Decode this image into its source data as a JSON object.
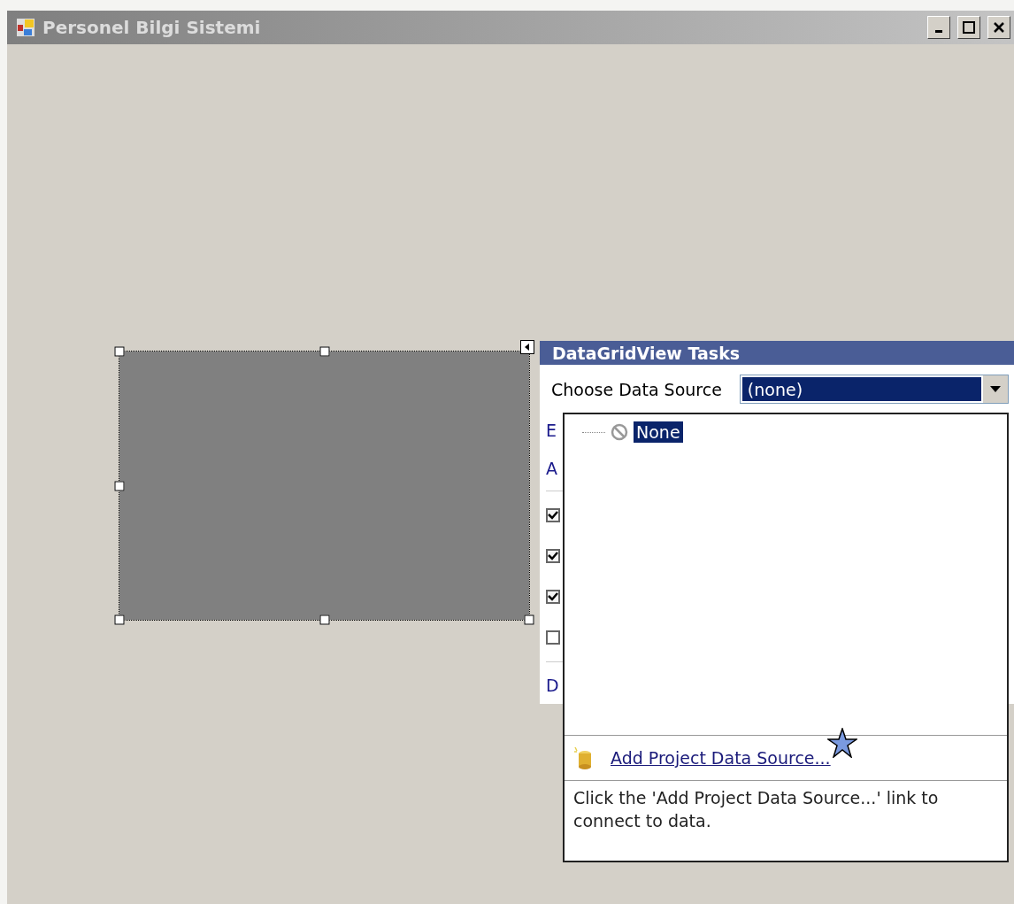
{
  "window": {
    "title": "Personel Bilgi Sistemi"
  },
  "tasks_panel": {
    "title": "DataGridView Tasks",
    "data_source": {
      "label": "Choose Data Source",
      "value": "(none)",
      "expanded": true
    },
    "items": [
      {
        "kind": "link",
        "text": "E"
      },
      {
        "kind": "link",
        "text": "A"
      },
      {
        "kind": "divider"
      },
      {
        "kind": "checkbox",
        "checked": true
      },
      {
        "kind": "checkbox",
        "checked": true
      },
      {
        "kind": "checkbox",
        "checked": true
      },
      {
        "kind": "checkbox",
        "checked": false
      },
      {
        "kind": "divider"
      },
      {
        "kind": "link",
        "text": "D"
      }
    ]
  },
  "dropdown": {
    "tree": [
      {
        "label": "None",
        "selected": true
      }
    ],
    "add_link": "Add Project Data Source...",
    "help": "Click the 'Add Project Data Source...' link to connect to data."
  }
}
